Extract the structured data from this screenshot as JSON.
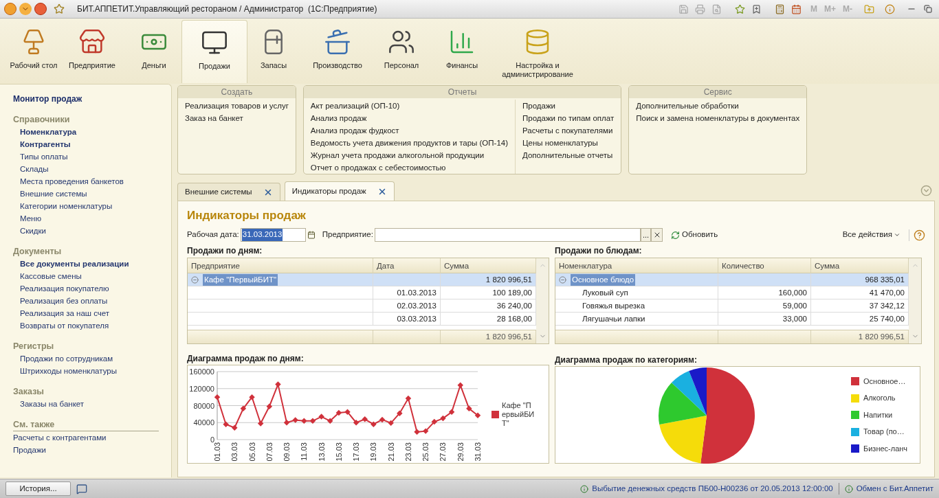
{
  "window": {
    "title": "БИТ.АППЕТИТ.Управляющий рестораном / Администратор  (1С:Предприятие)",
    "memory_buttons": [
      "M",
      "M+",
      "M-"
    ]
  },
  "nav": [
    {
      "label": "Рабочий стол",
      "kind": "desk",
      "selected": false
    },
    {
      "label": "Предприятие",
      "kind": "store",
      "selected": false
    },
    {
      "label": "Деньги",
      "kind": "money",
      "selected": false
    },
    {
      "label": "Продажи",
      "kind": "pos",
      "selected": true
    },
    {
      "label": "Запасы",
      "kind": "fridge",
      "selected": false
    },
    {
      "label": "Производство",
      "kind": "pot",
      "selected": false
    },
    {
      "label": "Персонал",
      "kind": "staff",
      "selected": false
    },
    {
      "label": "Финансы",
      "kind": "chart",
      "selected": false
    },
    {
      "label": "Настройка и администрирование",
      "kind": "admin",
      "selected": false
    }
  ],
  "sidebar": {
    "top_link": "Монитор продаж",
    "sections": [
      {
        "title": "Справочники",
        "see_also": false,
        "items": [
          {
            "label": "Номенклатура",
            "bold": true
          },
          {
            "label": "Контрагенты",
            "bold": true
          },
          {
            "label": "Типы оплаты",
            "bold": false
          },
          {
            "label": "Склады",
            "bold": false
          },
          {
            "label": "Места проведения банкетов",
            "bold": false
          },
          {
            "label": "Внешние системы",
            "bold": false
          },
          {
            "label": "Категории номенклатуры",
            "bold": false
          },
          {
            "label": "Меню",
            "bold": false
          },
          {
            "label": "Скидки",
            "bold": false
          }
        ]
      },
      {
        "title": "Документы",
        "see_also": false,
        "items": [
          {
            "label": "Все документы реализации",
            "bold": true
          },
          {
            "label": "Кассовые смены",
            "bold": false
          },
          {
            "label": "Реализация покупателю",
            "bold": false
          },
          {
            "label": "Реализация без оплаты",
            "bold": false
          },
          {
            "label": "Реализация за наш счет",
            "bold": false
          },
          {
            "label": "Возвраты от покупателя",
            "bold": false
          }
        ]
      },
      {
        "title": "Регистры",
        "see_also": false,
        "items": [
          {
            "label": "Продажи по сотрудникам",
            "bold": false
          },
          {
            "label": "Штрихкоды номенклатуры",
            "bold": false
          }
        ]
      },
      {
        "title": "Заказы",
        "see_also": false,
        "items": [
          {
            "label": "Заказы на банкет",
            "bold": false
          }
        ]
      },
      {
        "title": "См. также",
        "see_also": true,
        "items": [
          {
            "label": "Расчеты с контрагентами",
            "bold": false
          },
          {
            "label": "Продажи",
            "bold": false
          }
        ]
      }
    ]
  },
  "command_groups": [
    {
      "title": "Создать",
      "columns": [
        [
          "Реализация товаров и услуг",
          "Заказ на банкет"
        ]
      ]
    },
    {
      "title": "Отчеты",
      "columns": [
        [
          "Акт реализаций (ОП-10)",
          "Анализ продаж",
          "Анализ продаж фудкост",
          "Ведомость учета движения продуктов и тары (ОП-14)",
          "Журнал учета продажи алкогольной продукции",
          "Отчет о продажах с себестоимостью"
        ],
        [
          "Продажи",
          "Продажи по типам оплат",
          "Расчеты с покупателями",
          "Цены номенклатуры",
          "Дополнительные отчеты"
        ]
      ]
    },
    {
      "title": "Сервис",
      "columns": [
        [
          "Дополнительные обработки",
          "Поиск и замена номенклатуры в документах"
        ]
      ]
    }
  ],
  "tabs": [
    {
      "label": "Внешние системы",
      "selected": false
    },
    {
      "label": "Индикаторы продаж",
      "selected": true
    }
  ],
  "form": {
    "title": "Индикаторы продаж",
    "date_label": "Рабочая дата:",
    "date_value": "31.03.2013",
    "enterprise_label": "Предприятие:",
    "choose_button": "...",
    "refresh": "Обновить",
    "all_actions": "Все действия"
  },
  "tables": [
    {
      "title": "Продажи по дням:",
      "columns": [
        "Предприятие",
        "Дата",
        "Сумма"
      ],
      "rows": [
        {
          "kind": "group",
          "expanded": true,
          "selected": true,
          "cells": [
            "Кафе \"ПервыйБИТ\"",
            null,
            "1 820 996,51"
          ]
        },
        {
          "kind": "item",
          "selected": false,
          "cells": [
            null,
            "01.03.2013",
            "100 189,00"
          ]
        },
        {
          "kind": "item",
          "selected": false,
          "cells": [
            null,
            "02.03.2013",
            "36 240,00"
          ]
        },
        {
          "kind": "item",
          "selected": false,
          "cells": [
            null,
            "03.03.2013",
            "28 168,00"
          ]
        }
      ],
      "total": "1 820 996,51"
    },
    {
      "title": "Продажи по блюдам:",
      "columns": [
        "Номенклатура",
        "Количество",
        "Сумма"
      ],
      "rows": [
        {
          "kind": "group",
          "expanded": true,
          "selected": true,
          "cells": [
            "Основное блюдо",
            null,
            "968 335,01"
          ]
        },
        {
          "kind": "item",
          "selected": false,
          "cells": [
            "Луковый суп",
            "160,000",
            "41 470,00"
          ]
        },
        {
          "kind": "item",
          "selected": false,
          "cells": [
            "Говяжья вырезка",
            "59,000",
            "37 342,12"
          ]
        },
        {
          "kind": "item",
          "selected": false,
          "cells": [
            "Лягушачьи лапки",
            "33,000",
            "25 740,00"
          ]
        }
      ],
      "total": "1 820 996,51"
    }
  ],
  "line_chart": {
    "title": "Диаграмма продаж по дням:",
    "chart_data": {
      "type": "line",
      "categories": [
        "01.03",
        null,
        "03.03",
        null,
        "05.03",
        null,
        "07.03",
        null,
        "09.03",
        null,
        "11.03",
        null,
        "13.03",
        null,
        "15.03",
        null,
        "17.03",
        null,
        "19.03",
        null,
        "21.03",
        null,
        "23.03",
        null,
        "25.03",
        null,
        "27.03",
        null,
        "29.03",
        null,
        "31.03"
      ],
      "grid": true,
      "series": [
        {
          "name": "Кафе \"ПервыйБИТ\"",
          "color": "#d0313b",
          "marker": "diamond",
          "values": [
            100000,
            36000,
            28000,
            73000,
            100000,
            38000,
            78000,
            130000,
            40000,
            46000,
            44000,
            44000,
            54000,
            44000,
            63000,
            65000,
            40000,
            48000,
            36000,
            47000,
            39000,
            62000,
            97000,
            18000,
            20000,
            42000,
            50000,
            65000,
            128000,
            73000,
            57000
          ]
        }
      ],
      "ylim": [
        0,
        160000
      ],
      "yticks": [
        0,
        40000,
        80000,
        120000,
        160000
      ]
    }
  },
  "pie_chart": {
    "title": "Диаграмма продаж по категориям:",
    "legend": [
      {
        "label": "Основное…",
        "color": "#d0313b"
      },
      {
        "label": "Алкоголь",
        "color": "#f5dc0a"
      },
      {
        "label": "Напитки",
        "color": "#2ec92e"
      },
      {
        "label": "Товар (по…",
        "color": "#1ab0e0"
      },
      {
        "label": "Бизнес-ланч",
        "color": "#1a1ac8"
      }
    ]
  },
  "status_bar": {
    "history_button": "История...",
    "messages": [
      "Выбытие денежных средств ПБ00-Н00236 от 20.05.2013 12:00:00",
      "Обмен с Бит.Аппетит"
    ]
  }
}
